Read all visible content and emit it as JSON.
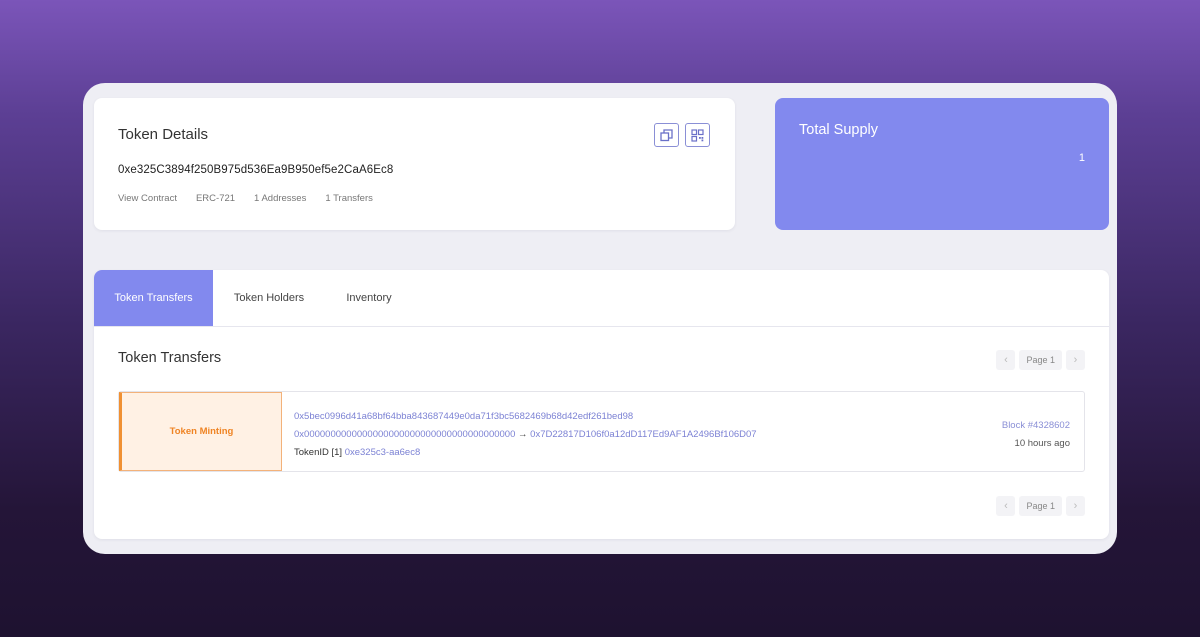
{
  "details": {
    "title": "Token Details",
    "address": "0xe325C3894f250B975d536Ea9B950ef5e2CaA6Ec8",
    "meta": [
      "View Contract",
      "ERC-721",
      "1 Addresses",
      "1 Transfers"
    ]
  },
  "supply": {
    "label": "Total Supply",
    "value": "1"
  },
  "tabs": [
    {
      "label": "Token Transfers",
      "active": true
    },
    {
      "label": "Token Holders",
      "active": false
    },
    {
      "label": "Inventory",
      "active": false
    }
  ],
  "section": {
    "title": "Token Transfers"
  },
  "pager": {
    "prev_icon": "chevron-left-icon",
    "next_icon": "chevron-right-icon",
    "page_label": "Page 1"
  },
  "transfer": {
    "type_label": "Token Minting",
    "tx_hash": "0x5bec0996d41a68bf64bba843687449e0da71f3bc5682469b68d42edf261bed98",
    "from": "0x0000000000000000000000000000000000000000",
    "arrow": "→",
    "to": "0x7D22817D106f0a12dD117Ed9AF1A2496Bf106D07",
    "token_id_prefix": "TokenID [1]",
    "token_id_link": "0xe325c3-aa6ec8",
    "block": "Block #4328602",
    "time": "10 hours ago"
  },
  "colors": {
    "accent": "#8289ee",
    "minting_orange": "#f09032",
    "link": "#7c82d4"
  }
}
